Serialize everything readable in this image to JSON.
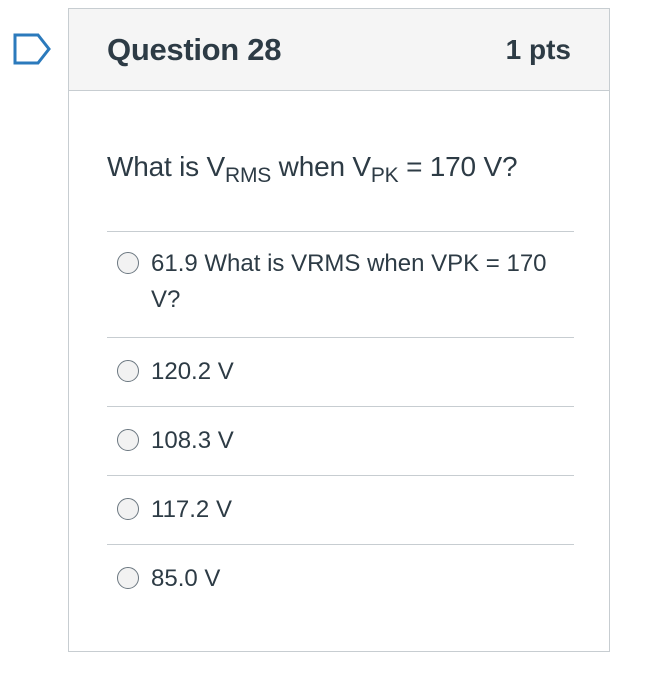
{
  "question": {
    "title": "Question 28",
    "points": "1 pts",
    "text_prefix": "What is V",
    "text_sub1": "RMS",
    "text_mid": " when V",
    "text_sub2": "PK",
    "text_suffix": " = 170 V?"
  },
  "answers": [
    {
      "label": "61.9 What is VRMS when VPK = 170 V?"
    },
    {
      "label": "120.2 V"
    },
    {
      "label": "108.3 V"
    },
    {
      "label": "117.2 V"
    },
    {
      "label": "85.0 V"
    }
  ],
  "colors": {
    "flag_outline": "#2b7abc",
    "border": "#c7cdd1",
    "header_bg": "#f5f5f5",
    "text": "#2d3b45"
  }
}
